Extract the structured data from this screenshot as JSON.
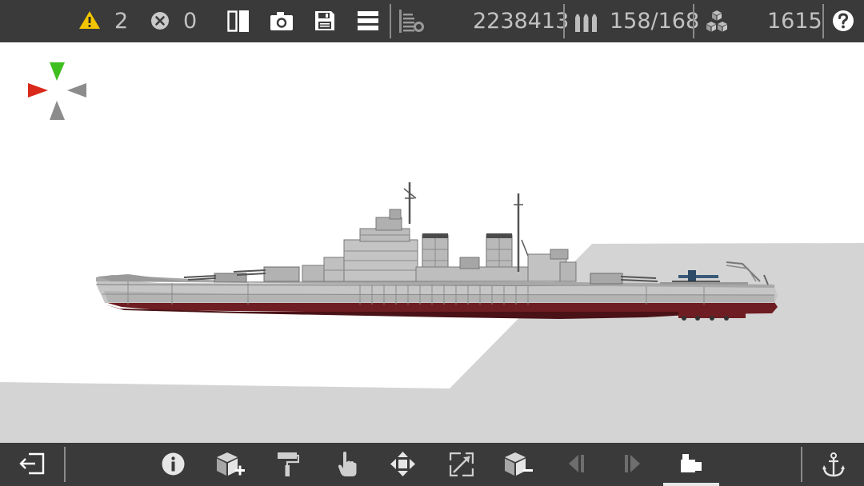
{
  "topbar": {
    "warnings_count": "2",
    "errors_count": "0",
    "cost": "2238413",
    "ammo": "158/168",
    "parts": "1615",
    "icons": {
      "warning": "warning-icon",
      "error": "error-icon",
      "mirror": "mirror-icon",
      "camera": "camera-icon",
      "save": "save-icon",
      "menu": "menu-icon",
      "depth": "depth-icon",
      "ammo": "ammo-icon",
      "parts": "parts-icon",
      "help": "help-icon"
    }
  },
  "bottombar": {
    "tools": [
      "exit-icon",
      "info-icon",
      "add-part-icon",
      "paint-roller-icon",
      "hand-icon",
      "move-icon",
      "rotate-frame-icon",
      "remove-part-icon",
      "previous-icon",
      "next-icon",
      "camera-mode-icon",
      "anchor-icon"
    ],
    "active_tool": "camera-mode-icon"
  },
  "colors": {
    "bar_background": "#3a3a3a",
    "warning": "#f2c500",
    "axis_green": "#3fbf1f",
    "axis_red": "#d9291b",
    "axis_gray": "#8c8c8c",
    "hull_gray": "#c6c6c6",
    "hull_red": "#6e1d22",
    "ground": "#d4d4d4"
  }
}
